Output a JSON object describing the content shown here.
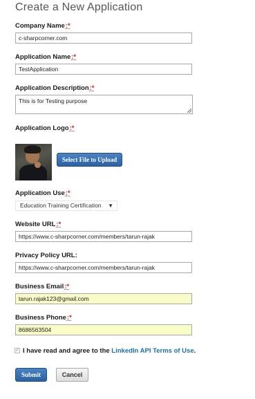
{
  "page": {
    "title": "Create a New Application"
  },
  "fields": {
    "required_mark": ":*",
    "company_name": {
      "label": "Company Name",
      "value": "c-sharpcorner.com"
    },
    "application_name": {
      "label": "Application Name",
      "value": "TestApplication"
    },
    "application_description": {
      "label": "Application Description",
      "value": "This is for Testing purpose"
    },
    "application_logo": {
      "label": "Application Logo",
      "upload_button": "Select File to Upload"
    },
    "application_use": {
      "label": "Application Use",
      "selected": "Education Training Certification",
      "arrow": "▼"
    },
    "website_url": {
      "label": "Website URL",
      "value": "https://www.c-sharpcorner.com/members/tarun-rajak"
    },
    "privacy_policy_url": {
      "label": "Privacy Policy URL:",
      "value": "https://www.c-sharpcorner.com/members/tarun-rajak"
    },
    "business_email": {
      "label": "Business Email",
      "value": "tarun.rajak123@gmail.com"
    },
    "business_phone": {
      "label": "Business Phone",
      "value": "8686563504"
    }
  },
  "agreement": {
    "checked": true,
    "check_glyph": "✓",
    "text_prefix": "I have read and agree to the ",
    "link_text": "LinkedIn API Terms of Use",
    "text_suffix": "."
  },
  "actions": {
    "submit_label": "Submit",
    "cancel_label": "Cancel"
  },
  "colors": {
    "primary_button": "#2a62a4",
    "required_mark": "#d02020",
    "link": "#1a6fb5",
    "autofill_field": "#fafcc8"
  }
}
